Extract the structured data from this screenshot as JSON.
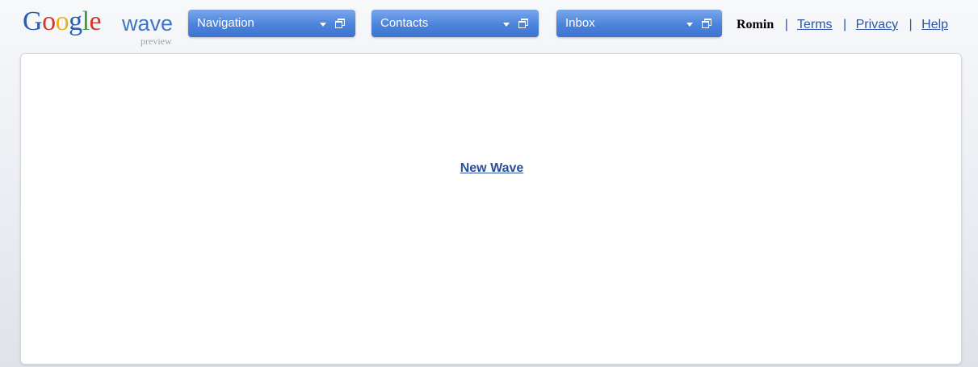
{
  "logo": {
    "google_letters": [
      "G",
      "o",
      "o",
      "g",
      "l",
      "e"
    ],
    "wave": "wave",
    "preview": "preview"
  },
  "panels": {
    "navigation": {
      "label": "Navigation"
    },
    "contacts": {
      "label": "Contacts"
    },
    "inbox": {
      "label": "Inbox"
    }
  },
  "user": {
    "name": "Romin",
    "separator": "|",
    "links": {
      "terms": "Terms",
      "privacy": "Privacy",
      "help": "Help"
    }
  },
  "main": {
    "new_wave_label": "New Wave"
  },
  "colors": {
    "panel_button": "#4c84dc",
    "link": "#2b55a6",
    "background": "#e9ecf1"
  },
  "icons": {
    "dropdown": "chevron-down-icon",
    "restore": "restore-window-icon"
  }
}
